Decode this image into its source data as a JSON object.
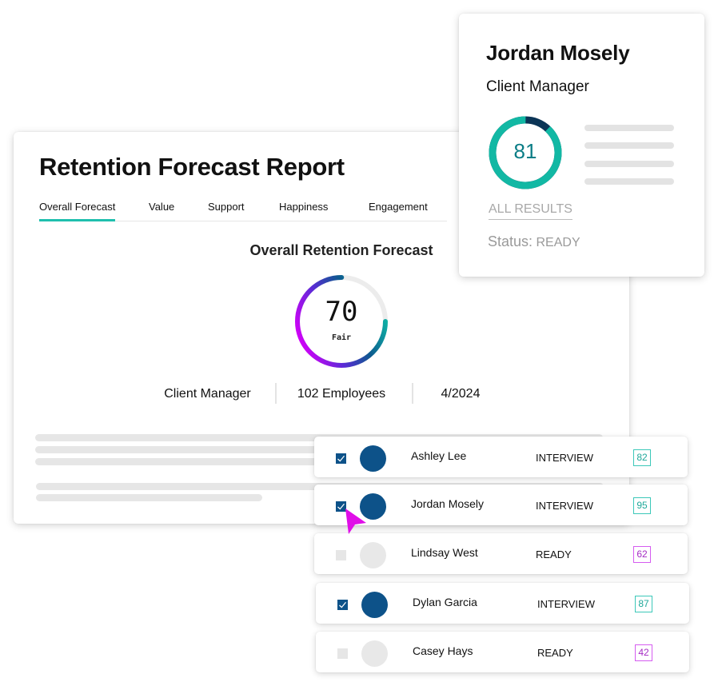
{
  "report": {
    "title": "Retention Forecast Report",
    "tabs": [
      {
        "label": "Overall Forecast",
        "active": true
      },
      {
        "label": "Value",
        "active": false
      },
      {
        "label": "Support",
        "active": false
      },
      {
        "label": "Happiness",
        "active": false
      },
      {
        "label": "Engagement",
        "active": false
      }
    ],
    "section_title": "Overall Retention Forecast",
    "gauge": {
      "value": "70",
      "label": "Fair",
      "fill_fraction": 0.75
    },
    "meta": {
      "role": "Client Manager",
      "employees": "102 Employees",
      "date": "4/2024"
    }
  },
  "profile": {
    "name": "Jordan Mosely",
    "role": "Client Manager",
    "score": "81",
    "all_results_label": "ALL RESULTS",
    "status_label": "Status:",
    "status_value": "READY"
  },
  "candidates": [
    {
      "name": "Ashley Lee",
      "status": "INTERVIEW",
      "score": "82",
      "checked": true
    },
    {
      "name": "Jordan Mosely",
      "status": "INTERVIEW",
      "score": "95",
      "checked": true
    },
    {
      "name": "Lindsay West",
      "status": "READY",
      "score": "62",
      "checked": false
    },
    {
      "name": "Dylan Garcia",
      "status": "INTERVIEW",
      "score": "87",
      "checked": true
    },
    {
      "name": "Casey Hays",
      "status": "READY",
      "score": "42",
      "checked": false
    }
  ],
  "icons": {
    "cursor": "pointer-arrow-icon",
    "check": "checkmark-icon"
  },
  "colors": {
    "accent_teal": "#1fbfae",
    "navy": "#0d5289",
    "magenta": "#d500f9",
    "score_high": "#3cc8b9",
    "score_low": "#d55cf0"
  }
}
